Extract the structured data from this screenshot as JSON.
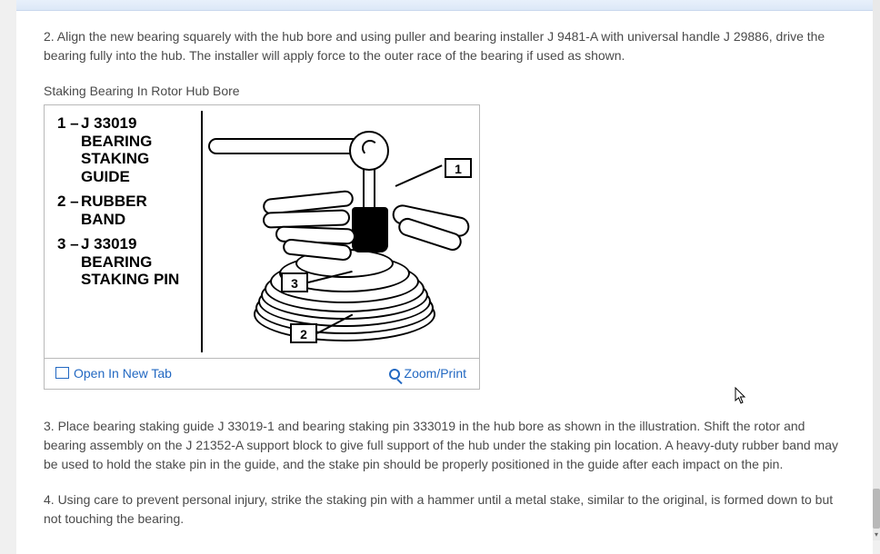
{
  "steps": {
    "s2": " 2. Align the new bearing squarely with the hub bore and using puller and bearing installer J 9481-A with universal handle J 29886, drive the bearing fully into the hub. The installer will apply force to the outer race of the bearing if used as shown.",
    "s3": " 3. Place bearing staking guide J 33019-1 and bearing staking pin 333019 in the hub bore as shown in the illustration. Shift the rotor and bearing assembly on the J 21352-A support block to give full support of the hub under the staking pin location. A heavy-duty rubber band may be used to hold the stake pin in the guide, and the stake pin should be properly positioned in the guide after each impact on the pin.",
    "s4": " 4. Using care to prevent personal injury, strike the staking pin with a hammer until a metal stake, similar to the original, is formed down to but not touching the bearing."
  },
  "figure": {
    "caption": "Staking Bearing In Rotor Hub Bore",
    "legend": [
      {
        "num": "1 –",
        "txt": "J 33019 BEARING STAKING GUIDE"
      },
      {
        "num": "2 –",
        "txt": "RUBBER BAND"
      },
      {
        "num": "3 –",
        "txt": "J 33019 BEARING STAKING PIN"
      }
    ],
    "callouts": {
      "c1": "1",
      "c2": "2",
      "c3": "3"
    },
    "actions": {
      "open": "Open In New Tab",
      "zoom": "Zoom/Print"
    }
  }
}
